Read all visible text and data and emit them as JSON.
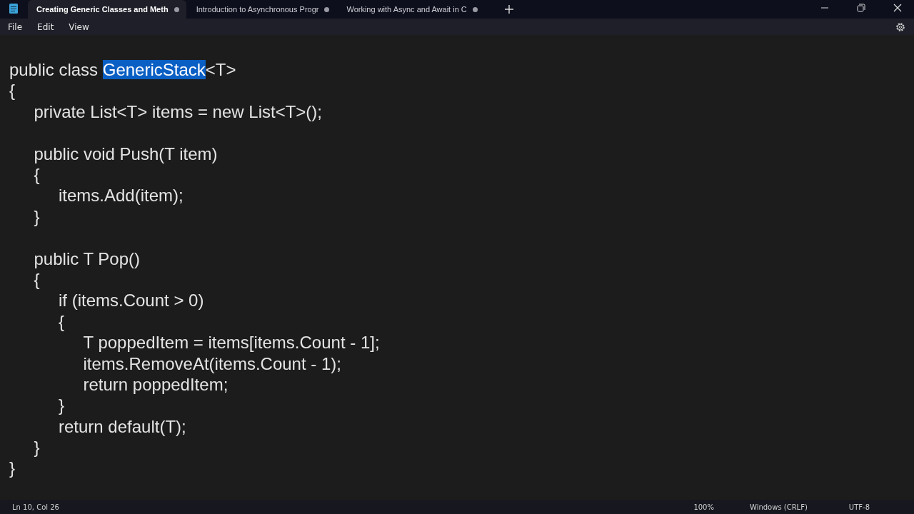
{
  "tabs": [
    {
      "title": "Creating Generic Classes and Meth",
      "selected": true
    },
    {
      "title": "Introduction to Asynchronous Progr",
      "selected": false
    },
    {
      "title": "Working with Async and Await in C",
      "selected": false
    }
  ],
  "menu": [
    "File",
    "Edit",
    "View"
  ],
  "editor": {
    "blocks": [
      [
        {
          "segments": [
            {
              "text": "public class ",
              "selected": false
            },
            {
              "text": "GenericStack",
              "selected": true
            },
            {
              "text": "<T>",
              "selected": false
            }
          ]
        },
        {
          "segments": [
            {
              "text": "{",
              "selected": false
            }
          ]
        },
        {
          "segments": [
            {
              "text": "\tprivate List<T> items = new List<T>();",
              "selected": false
            }
          ]
        }
      ],
      [
        {
          "segments": [
            {
              "text": "\tpublic void Push(T item)",
              "selected": false
            }
          ]
        },
        {
          "segments": [
            {
              "text": "\t{",
              "selected": false
            }
          ]
        },
        {
          "segments": [
            {
              "text": "\t\titems.Add(item);",
              "selected": false
            }
          ]
        },
        {
          "segments": [
            {
              "text": "\t}",
              "selected": false
            }
          ]
        }
      ],
      [
        {
          "segments": [
            {
              "text": "\tpublic T Pop()",
              "selected": false
            }
          ]
        },
        {
          "segments": [
            {
              "text": "\t{",
              "selected": false
            }
          ]
        },
        {
          "segments": [
            {
              "text": "\t\tif (items.Count > 0)",
              "selected": false
            }
          ]
        },
        {
          "segments": [
            {
              "text": "\t\t{",
              "selected": false
            }
          ]
        },
        {
          "segments": [
            {
              "text": "\t\t\tT poppedItem = items[items.Count - 1];",
              "selected": false
            }
          ]
        },
        {
          "segments": [
            {
              "text": "\t\t\titems.RemoveAt(items.Count - 1);",
              "selected": false
            }
          ]
        },
        {
          "segments": [
            {
              "text": "\t\t\treturn poppedItem;",
              "selected": false
            }
          ]
        },
        {
          "segments": [
            {
              "text": "\t\t}",
              "selected": false
            }
          ]
        },
        {
          "segments": [
            {
              "text": "\t\treturn default(T);",
              "selected": false
            }
          ]
        },
        {
          "segments": [
            {
              "text": "\t}",
              "selected": false
            }
          ]
        },
        {
          "segments": [
            {
              "text": "}",
              "selected": false
            }
          ]
        }
      ]
    ]
  },
  "status_bar": {
    "position": "Ln 10, Col 26",
    "zoom": "100%",
    "line_ending": "Windows (CRLF)",
    "encoding": "UTF-8"
  }
}
